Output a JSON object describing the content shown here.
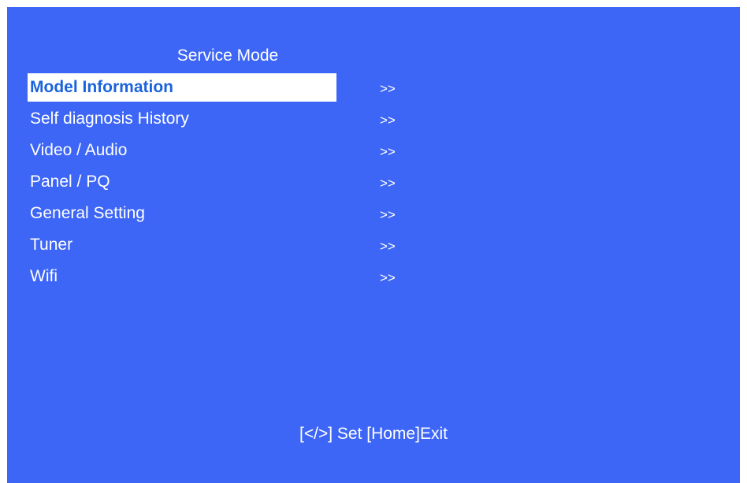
{
  "title": "Service Mode",
  "menu": {
    "items": [
      {
        "label": "Model Information",
        "arrow": ">>",
        "selected": true
      },
      {
        "label": "Self diagnosis History",
        "arrow": ">>",
        "selected": false
      },
      {
        "label": "Video / Audio",
        "arrow": ">>",
        "selected": false
      },
      {
        "label": "Panel / PQ",
        "arrow": ">>",
        "selected": false
      },
      {
        "label": "General Setting",
        "arrow": ">>",
        "selected": false
      },
      {
        "label": "Tuner",
        "arrow": ">>",
        "selected": false
      },
      {
        "label": "Wifi",
        "arrow": ">>",
        "selected": false
      }
    ]
  },
  "footer": {
    "hint": "[</>] Set [Home]Exit"
  },
  "colors": {
    "background": "#3d66f7",
    "highlight_bg": "#ffffff",
    "highlight_text": "#1b63dc",
    "text": "#ffffff"
  }
}
